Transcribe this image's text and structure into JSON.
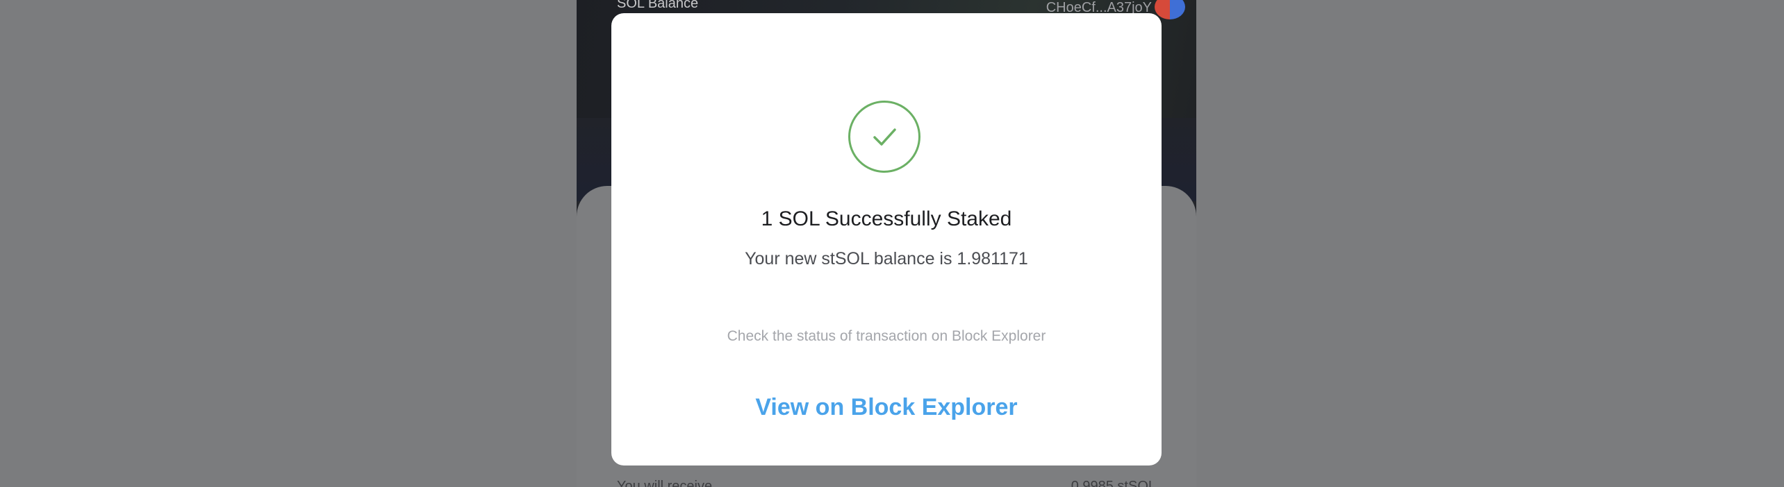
{
  "background_app": {
    "balance_label": "SOL Balance",
    "wallet_address": "CHoeCf...A37joY",
    "hint_label": "You will receive",
    "hint_value": "0.9985 stSOL"
  },
  "modal": {
    "title": "1 SOL Successfully Staked",
    "subtitle": "Your new stSOL balance is 1.981171",
    "status_text": "Check the status of transaction on Block Explorer",
    "link_label": "View on Block Explorer"
  },
  "colors": {
    "success": "#6bb064",
    "link": "#4aa3ea",
    "overlay": "#7b7c7e"
  },
  "icons": {
    "success": "check-circle-icon"
  }
}
